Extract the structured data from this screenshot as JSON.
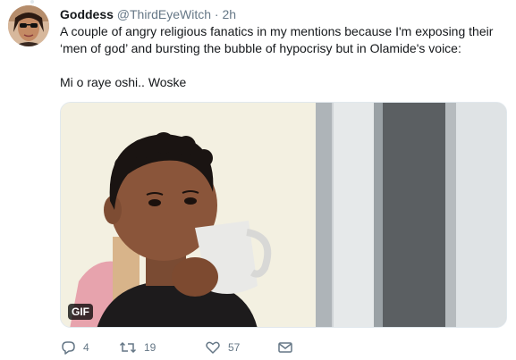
{
  "tweet": {
    "display_name": "Goddess",
    "handle": "@ThirdEyeWitch",
    "separator": "·",
    "time": "2h",
    "text_line1": "A couple of angry religious fanatics in my mentions because I'm exposing their ‘men of god’ and bursting the bubble of hypocrisy but in Olamide's voice:",
    "text_line2": "Mi o raye oshi.. Woske",
    "media": {
      "badge": "GIF"
    },
    "actions": {
      "reply_icon": "reply-icon",
      "reply_count": "4",
      "retweet_icon": "retweet-icon",
      "retweet_count": "19",
      "like_icon": "heart-icon",
      "like_count": "57",
      "dm_icon": "envelope-icon"
    }
  },
  "colors": {
    "text_primary": "#14171a",
    "text_secondary": "#657786",
    "border": "#e1e8ed"
  }
}
